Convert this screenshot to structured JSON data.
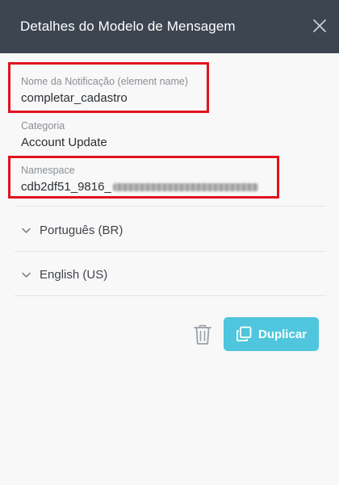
{
  "header": {
    "title": "Detalhes do Modelo de Mensagem"
  },
  "fields": {
    "notification_name": {
      "label": "Nome da Notificação (element name)",
      "value": "completar_cadastro"
    },
    "category": {
      "label": "Categoria",
      "value": "Account Update"
    },
    "namespace": {
      "label": "Namespace",
      "value_visible": "cdb2df51_9816_"
    }
  },
  "languages": [
    {
      "label": "Português (BR)"
    },
    {
      "label": "English (US)"
    }
  ],
  "actions": {
    "duplicate_label": "Duplicar"
  },
  "colors": {
    "header_bg": "#3c4550",
    "accent": "#4fc6dd",
    "highlight": "#e0141e"
  },
  "icons": [
    "close-icon",
    "chevron-down-icon",
    "trash-icon",
    "duplicate-icon"
  ]
}
